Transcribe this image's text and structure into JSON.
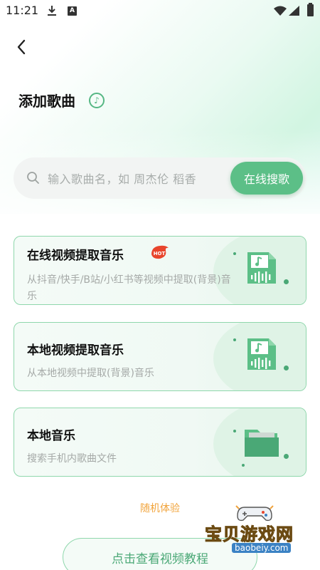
{
  "status_bar": {
    "time": "11:21",
    "icons": [
      "download-icon",
      "a-icon",
      "wifi-icon",
      "signal-icon",
      "battery-icon"
    ]
  },
  "header": {
    "back_icon": "chevron-left-icon",
    "title": "添加歌曲",
    "title_badge_icon": "music-note-icon"
  },
  "search": {
    "placeholder": "输入歌曲名，如 周杰伦 稻香",
    "button_label": "在线搜歌"
  },
  "cards": [
    {
      "title": "在线视频提取音乐",
      "badge": "HOT",
      "desc": "从抖音/快手/B站/小红书等视频中提取(背景)音乐",
      "icon": "audio-file-icon"
    },
    {
      "title": "本地视频提取音乐",
      "desc": "从本地视频中提取(背景)音乐",
      "icon": "audio-file-icon"
    },
    {
      "title": "本地音乐",
      "desc": "搜索手机内歌曲文件",
      "icon": "folder-icon"
    }
  ],
  "random_link": "随机体验",
  "tutorial_button": "点击查看视频教程",
  "watermark": {
    "text": "宝贝游戏网",
    "url": "baobeiy.com"
  },
  "colors": {
    "accent": "#5cbf87",
    "card_border": "#8fd7ac",
    "orange": "#f1a43c",
    "hot_red": "#e8452c"
  }
}
